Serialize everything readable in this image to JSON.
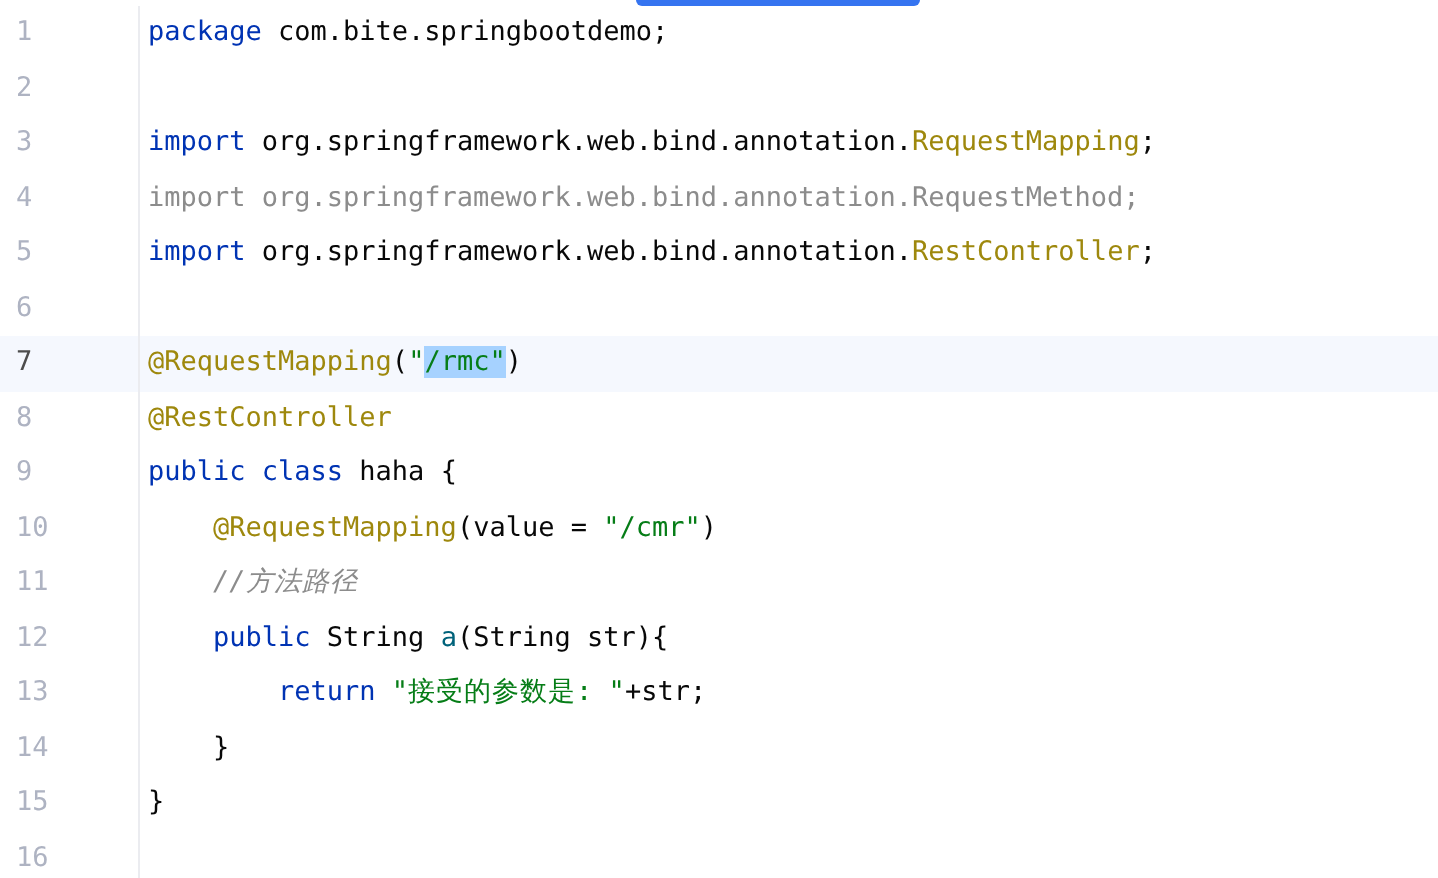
{
  "editor": {
    "lines": [
      {
        "number": "1",
        "current": false,
        "tokens": [
          {
            "kind": "keyword",
            "text": "package"
          },
          {
            "kind": "plain",
            "text": " com.bite.springbootdemo;"
          }
        ]
      },
      {
        "number": "2",
        "current": false
      },
      {
        "number": "3",
        "current": false,
        "tokens": [
          {
            "kind": "keyword",
            "text": "import"
          },
          {
            "kind": "plain",
            "text": " org.springframework.web.bind.annotation."
          },
          {
            "kind": "annotation",
            "text": "RequestMapping"
          },
          {
            "kind": "plain",
            "text": ";"
          }
        ]
      },
      {
        "number": "4",
        "current": false,
        "tokens": [
          {
            "kind": "unused",
            "text": "import org.springframework.web.bind.annotation.RequestMethod;"
          }
        ]
      },
      {
        "number": "5",
        "current": false,
        "tokens": [
          {
            "kind": "keyword",
            "text": "import"
          },
          {
            "kind": "plain",
            "text": " org.springframework.web.bind.annotation."
          },
          {
            "kind": "annotation",
            "text": "RestController"
          },
          {
            "kind": "plain",
            "text": ";"
          }
        ]
      },
      {
        "number": "6",
        "current": false
      },
      {
        "number": "7",
        "current": true,
        "tokens": [
          {
            "kind": "annotation",
            "text": "@RequestMapping"
          },
          {
            "kind": "plain",
            "text": "("
          },
          {
            "kind": "string",
            "text": "\""
          },
          {
            "kind": "selected_string",
            "text": "/rmc\""
          },
          {
            "kind": "plain",
            "text": ")"
          }
        ]
      },
      {
        "number": "8",
        "current": false,
        "tokens": [
          {
            "kind": "annotation",
            "text": "@RestController"
          }
        ]
      },
      {
        "number": "9",
        "current": false,
        "tokens": [
          {
            "kind": "keyword",
            "text": "public class"
          },
          {
            "kind": "plain",
            "text": " haha {"
          }
        ]
      },
      {
        "number": "10",
        "current": false,
        "tokens": [
          {
            "kind": "annotation",
            "text": "    @RequestMapping"
          },
          {
            "kind": "plain",
            "text": "(value = "
          },
          {
            "kind": "string",
            "text": "\"/cmr\""
          },
          {
            "kind": "plain",
            "text": ")"
          }
        ]
      },
      {
        "number": "11",
        "current": false,
        "tokens": [
          {
            "kind": "comment",
            "text": "    //方法路径"
          }
        ]
      },
      {
        "number": "12",
        "current": false,
        "tokens": [
          {
            "kind": "keyword",
            "text": "    public"
          },
          {
            "kind": "plain",
            "text": " String "
          },
          {
            "kind": "method",
            "text": "a"
          },
          {
            "kind": "plain",
            "text": "(String str){"
          }
        ]
      },
      {
        "number": "13",
        "current": false,
        "tokens": [
          {
            "kind": "keyword",
            "text": "        return "
          },
          {
            "kind": "string",
            "text": "\"接受的参数是: \""
          },
          {
            "kind": "plain",
            "text": "+str;"
          }
        ]
      },
      {
        "number": "14",
        "current": false,
        "tokens": [
          {
            "kind": "plain",
            "text": "    }"
          }
        ]
      },
      {
        "number": "15",
        "current": false,
        "tokens": [
          {
            "kind": "plain",
            "text": "}"
          }
        ]
      },
      {
        "number": "16",
        "current": false
      }
    ]
  }
}
